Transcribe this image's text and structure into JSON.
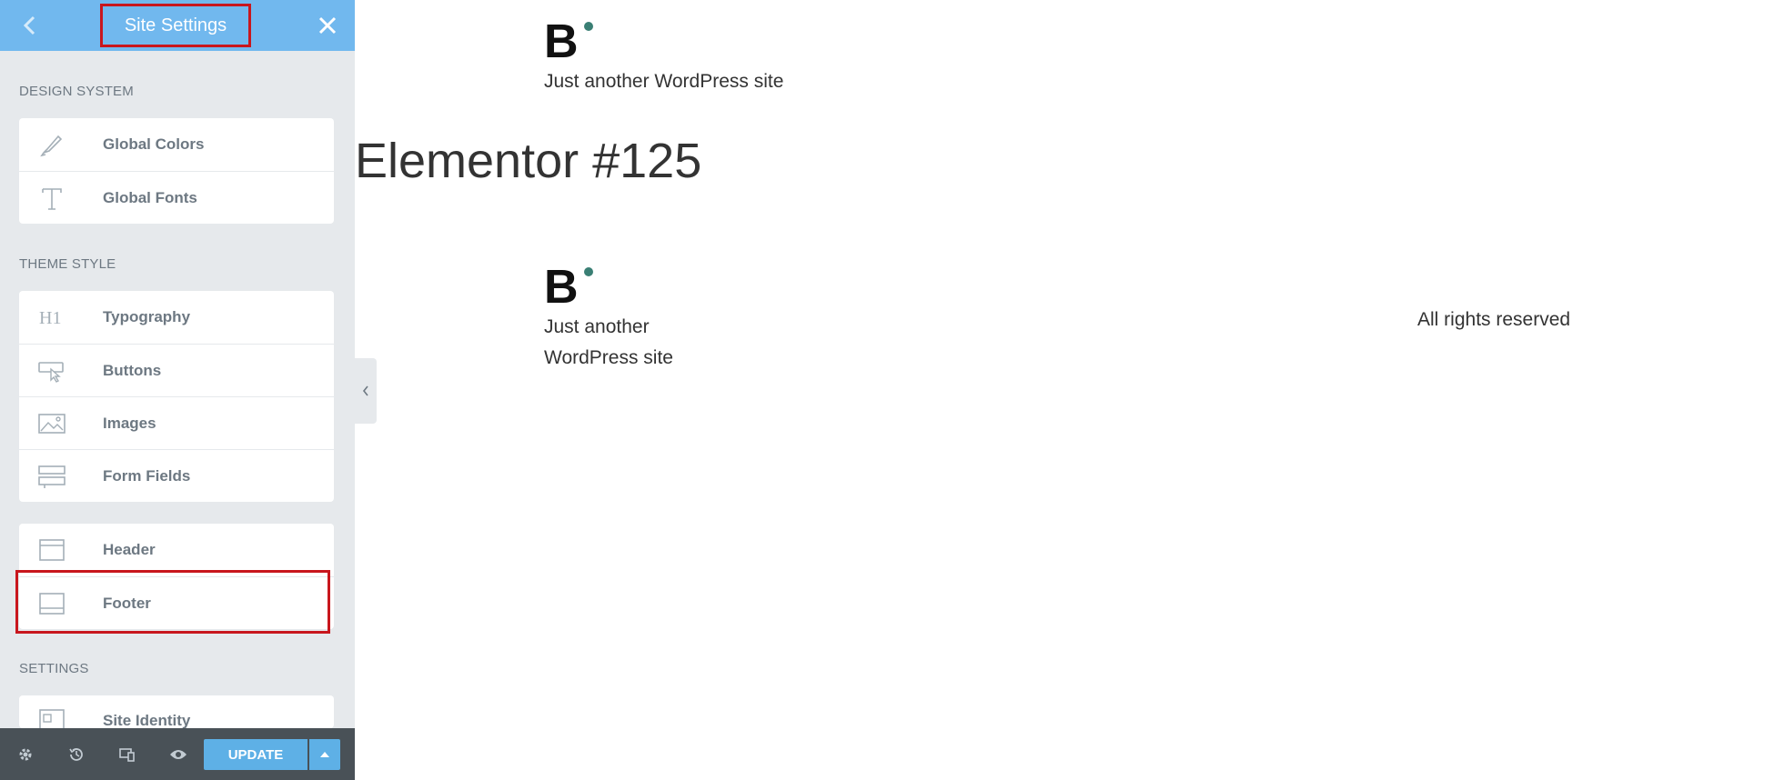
{
  "panel": {
    "title": "Site Settings",
    "sections": {
      "design_system": "DESIGN SYSTEM",
      "theme_style": "THEME STYLE",
      "settings": "SETTINGS"
    },
    "design_items": [
      "Global Colors",
      "Global Fonts"
    ],
    "theme_items": [
      "Typography",
      "Buttons",
      "Images",
      "Form Fields"
    ],
    "layout_items": [
      "Header",
      "Footer"
    ],
    "settings_items": [
      "Site Identity"
    ],
    "update_label": "UPDATE"
  },
  "preview": {
    "logo_text": "B",
    "header_tagline": "Just another WordPress site",
    "page_title": "Elementor #125",
    "footer_tagline_line1": "Just another",
    "footer_tagline_line2": "WordPress site",
    "rights": "All rights reserved"
  },
  "colors": {
    "header_bg": "#71b8ee",
    "panel_bg": "#e6e9ec",
    "highlight": "#c8161d",
    "logo_dot": "#3a7f74",
    "bottom_bar": "#495157"
  }
}
